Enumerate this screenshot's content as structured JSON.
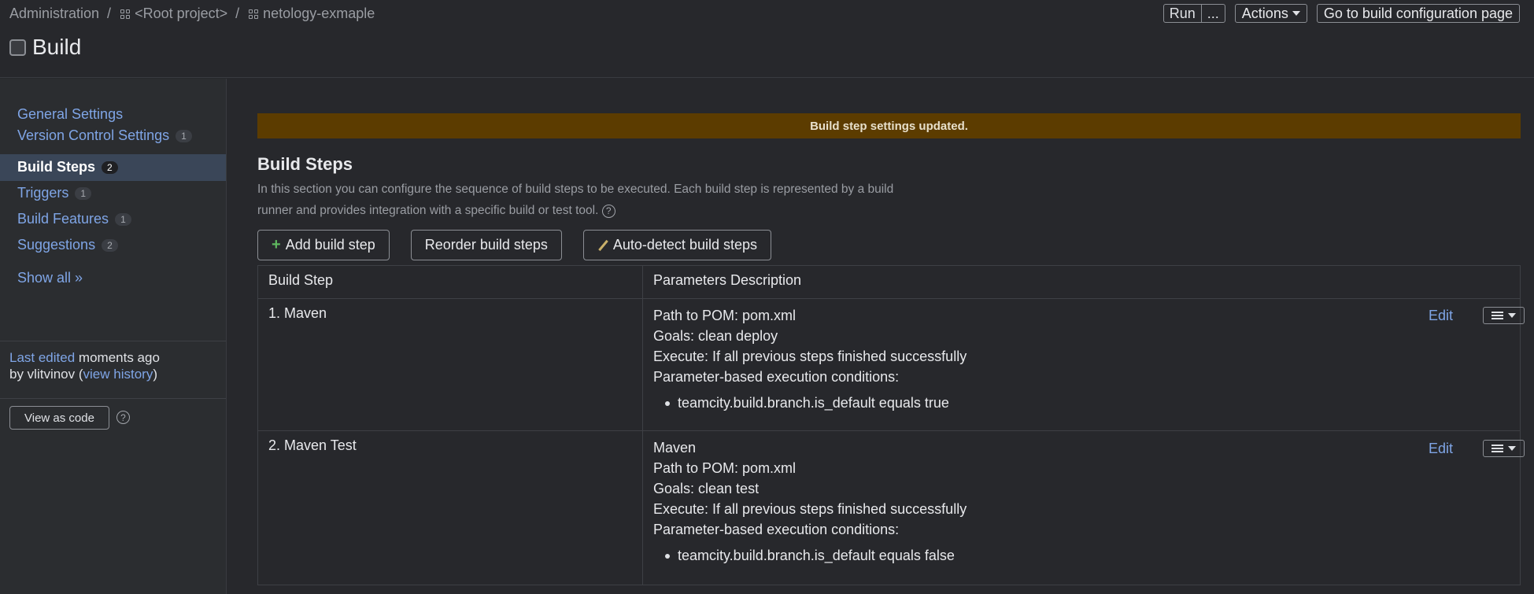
{
  "breadcrumb": {
    "admin": "Administration",
    "root": "<Root project>",
    "project": "netology-exmaple",
    "sep": "/"
  },
  "page_title": "Build",
  "top_actions": {
    "run": "Run",
    "more": "...",
    "actions": "Actions",
    "goto": "Go to build configuration page"
  },
  "sidebar": {
    "items": [
      {
        "label": "General Settings",
        "badge": ""
      },
      {
        "label": "Version Control Settings",
        "badge": "1"
      },
      {
        "label": "Build Steps",
        "badge": "2"
      },
      {
        "label": "Triggers",
        "badge": "1"
      },
      {
        "label": "Build Features",
        "badge": "1"
      },
      {
        "label": "Suggestions",
        "badge": "2"
      }
    ],
    "show_all": "Show all »",
    "last_edited_link": "Last edited",
    "last_edited_time": "moments ago",
    "by": "by vlitvinov",
    "view_history": "view history",
    "view_as_code": "View as code",
    "help": "?"
  },
  "banner": "Build step settings updated.",
  "section": {
    "title": "Build Steps",
    "desc": "In this section you can configure the sequence of build steps to be executed. Each build step is represented by a build runner and provides integration with a specific build or test tool.",
    "help": "?"
  },
  "buttons": {
    "add": "Add build step",
    "reorder": "Reorder build steps",
    "autodetect": "Auto-detect build steps",
    "plus": "+"
  },
  "table": {
    "headers": [
      "Build Step",
      "Parameters Description"
    ],
    "edit_label": "Edit",
    "rows": [
      {
        "name": "1. Maven",
        "runner": "",
        "pom": "Path to POM: pom.xml",
        "goals": "Goals: clean deploy",
        "execute": "Execute: If all previous steps finished successfully",
        "cond_title": "Parameter-based execution conditions:",
        "cond": "teamcity.build.branch.is_default equals true"
      },
      {
        "name": "2. Maven Test",
        "runner": "Maven",
        "pom": "Path to POM: pom.xml",
        "goals": "Goals: clean test",
        "execute": "Execute: If all previous steps finished successfully",
        "cond_title": "Parameter-based execution conditions:",
        "cond": "teamcity.build.branch.is_default equals false"
      }
    ]
  },
  "colors": {
    "accent": "#7fa5e6",
    "banner": "#5c3c00",
    "background": "#27282c"
  }
}
